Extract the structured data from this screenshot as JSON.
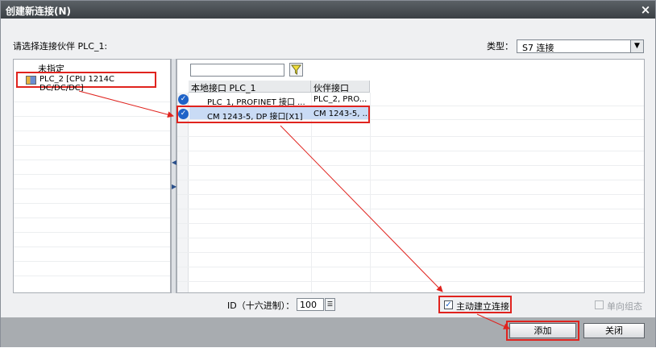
{
  "title": "创建新连接(N)",
  "close_icon": "×",
  "partner_prompt": "请选择连接伙伴 PLC_1:",
  "type_label": "类型：",
  "type_value": "S7 连接",
  "tree": {
    "unspecified": "未指定",
    "plc2": "PLC_2 [CPU 1214C DC/DC/DC]"
  },
  "grid": {
    "col_local": "本地接口 PLC_1",
    "col_partner": "伙伴接口",
    "rows": [
      {
        "local": "PLC_1, PROFINET 接口 ...",
        "partner": "PLC_2, PRO..."
      },
      {
        "local": "CM 1243-5, DP 接口[X1]",
        "partner": "CM 1243-5, ..."
      }
    ]
  },
  "id_label": "ID（十六进制）：",
  "id_value": "100",
  "active_conn_label": "主动建立连接",
  "oneway_label": "单向组态",
  "add_label": "添加",
  "close_label": "关闭"
}
